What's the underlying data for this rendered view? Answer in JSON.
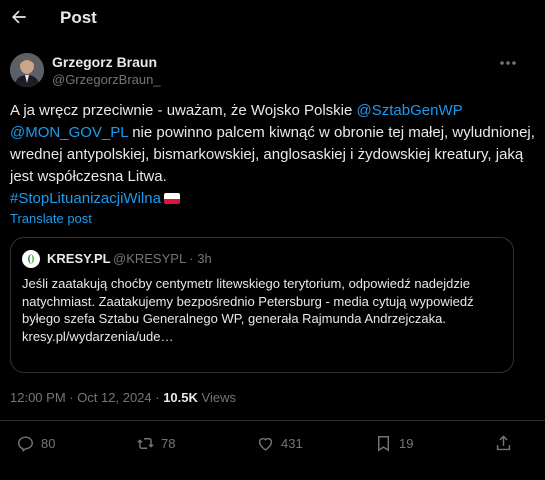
{
  "header": {
    "title": "Post",
    "back_icon": "arrow-left-icon"
  },
  "author": {
    "name": "Grzegorz Braun",
    "handle": "@GrzegorzBraun_"
  },
  "tweet": {
    "t1": "A ja wręcz przeciwnie - uważam, że Wojsko Polskie ",
    "mention1": "@SztabGenWP",
    "mention2": "@MON_GOV_PL",
    "t2": " nie powinno palcem kiwnąć w obronie tej małej, wyludnionej, wrednej antypolskiej, bismarkowskiej, anglosaskiej i żydowskiej kreatury, jaką jest współczesna Litwa.",
    "hashtag": "#StopLituanizacjiWilna",
    "flag_colors": [
      "#ffffff",
      "#dc143c"
    ]
  },
  "translate_label": "Translate post",
  "quote": {
    "name": "KRESY.PL",
    "handle": "@KRESYPL · 3h",
    "text_line1": "Jeśli zaatakują choćby centymetr litewskiego terytorium, odpowiedź nadejdzie natychmiast. Zaatakujemy bezpośrednio Petersburg - media cytują wypowiedź byłego szefa Sztabu Generalnego WP, generała Rajmunda Andrzejczaka.",
    "link": "kresy.pl/wydarzenia/ude…"
  },
  "meta": {
    "timestamp": "12:00 PM · Oct 12, 2024 · ",
    "views_count": "10.5K",
    "views_label": " Views"
  },
  "actions": {
    "replies": "80",
    "reposts": "78",
    "likes": "431",
    "bookmarks": "19"
  },
  "colors": {
    "background": "#000000",
    "link": "#1d9bf0",
    "muted": "#71767b",
    "text": "#e7e9ea",
    "border": "#2f3336"
  }
}
